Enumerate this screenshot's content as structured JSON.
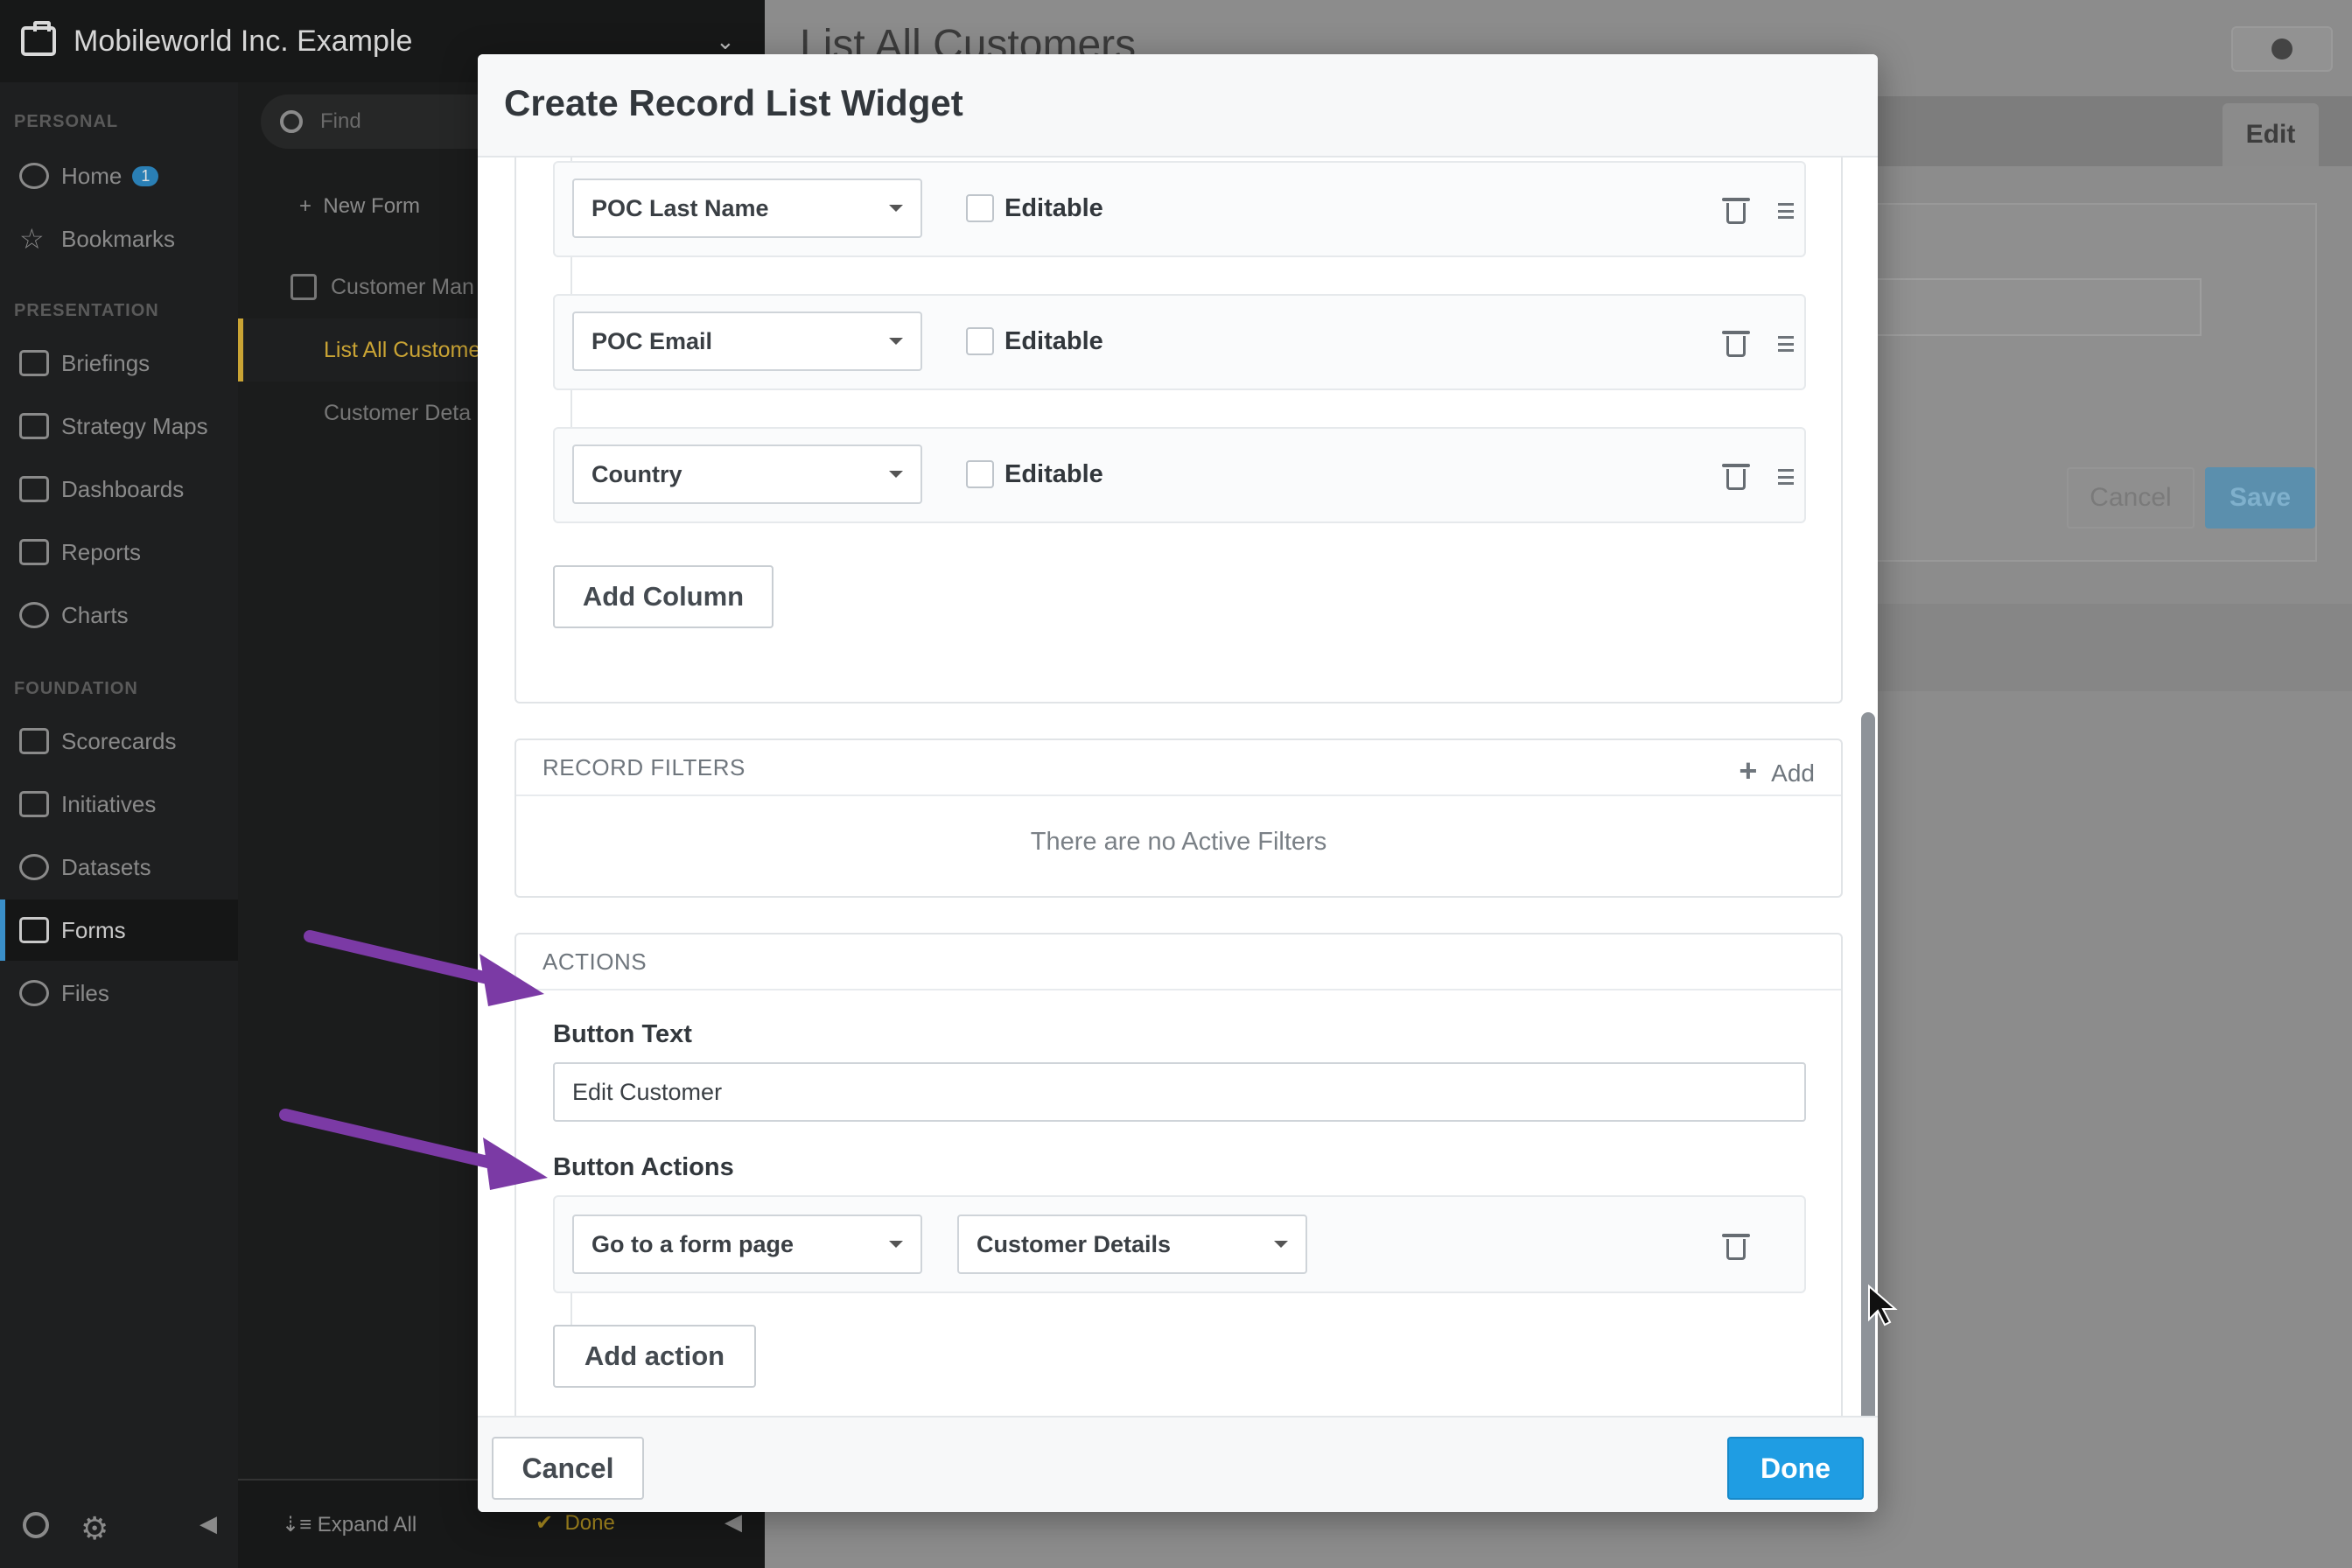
{
  "app": {
    "org_name": "Mobileworld Inc. Example"
  },
  "sidebar": {
    "sections": {
      "personal": "PERSONAL",
      "presentation": "PRESENTATION",
      "foundation": "FOUNDATION"
    },
    "items": [
      {
        "label": "Home",
        "icon": "user-icon",
        "badge": "1"
      },
      {
        "label": "Bookmarks",
        "icon": "star-icon"
      },
      {
        "label": "Briefings",
        "icon": "book-icon"
      },
      {
        "label": "Strategy Maps",
        "icon": "strategy-map-icon"
      },
      {
        "label": "Dashboards",
        "icon": "dashboard-icon"
      },
      {
        "label": "Reports",
        "icon": "report-icon"
      },
      {
        "label": "Charts",
        "icon": "pie-chart-icon"
      },
      {
        "label": "Scorecards",
        "icon": "scorecard-icon"
      },
      {
        "label": "Initiatives",
        "icon": "checkbox-icon"
      },
      {
        "label": "Datasets",
        "icon": "cube-icon"
      },
      {
        "label": "Forms",
        "icon": "form-icon",
        "active": true
      },
      {
        "label": "Files",
        "icon": "files-icon"
      }
    ]
  },
  "forms_panel": {
    "find_placeholder": "Find",
    "new_form": "New Form",
    "tree": [
      {
        "label": "Customer Man"
      },
      {
        "label": "List All Custome",
        "active": true
      },
      {
        "label": "Customer Deta"
      }
    ],
    "footer": {
      "expand_all": "Expand All",
      "done": "Done"
    }
  },
  "background_page": {
    "title": "List All Customers",
    "edit_tab": "Edit",
    "cancel": "Cancel",
    "save": "Save"
  },
  "modal": {
    "title": "Create Record List Widget",
    "columns": [
      {
        "field": "POC Last Name",
        "editable_label": "Editable",
        "editable": false
      },
      {
        "field": "POC Email",
        "editable_label": "Editable",
        "editable": false
      },
      {
        "field": "Country",
        "editable_label": "Editable",
        "editable": false
      }
    ],
    "add_column": "Add Column",
    "record_filters": {
      "heading": "RECORD FILTERS",
      "add": "Add",
      "empty": "There are no Active Filters"
    },
    "actions": {
      "heading": "ACTIONS",
      "button_text_label": "Button Text",
      "button_text_value": "Edit Customer",
      "button_actions_label": "Button Actions",
      "action_type": "Go to a form page",
      "action_target": "Customer Details",
      "add_action": "Add action"
    },
    "footer": {
      "cancel": "Cancel",
      "done": "Done"
    }
  },
  "colors": {
    "primary": "#1f9de3",
    "annotation_arrow": "#7b3aa5",
    "active_nav": "#3a8fc9",
    "active_tree": "#caa434"
  }
}
